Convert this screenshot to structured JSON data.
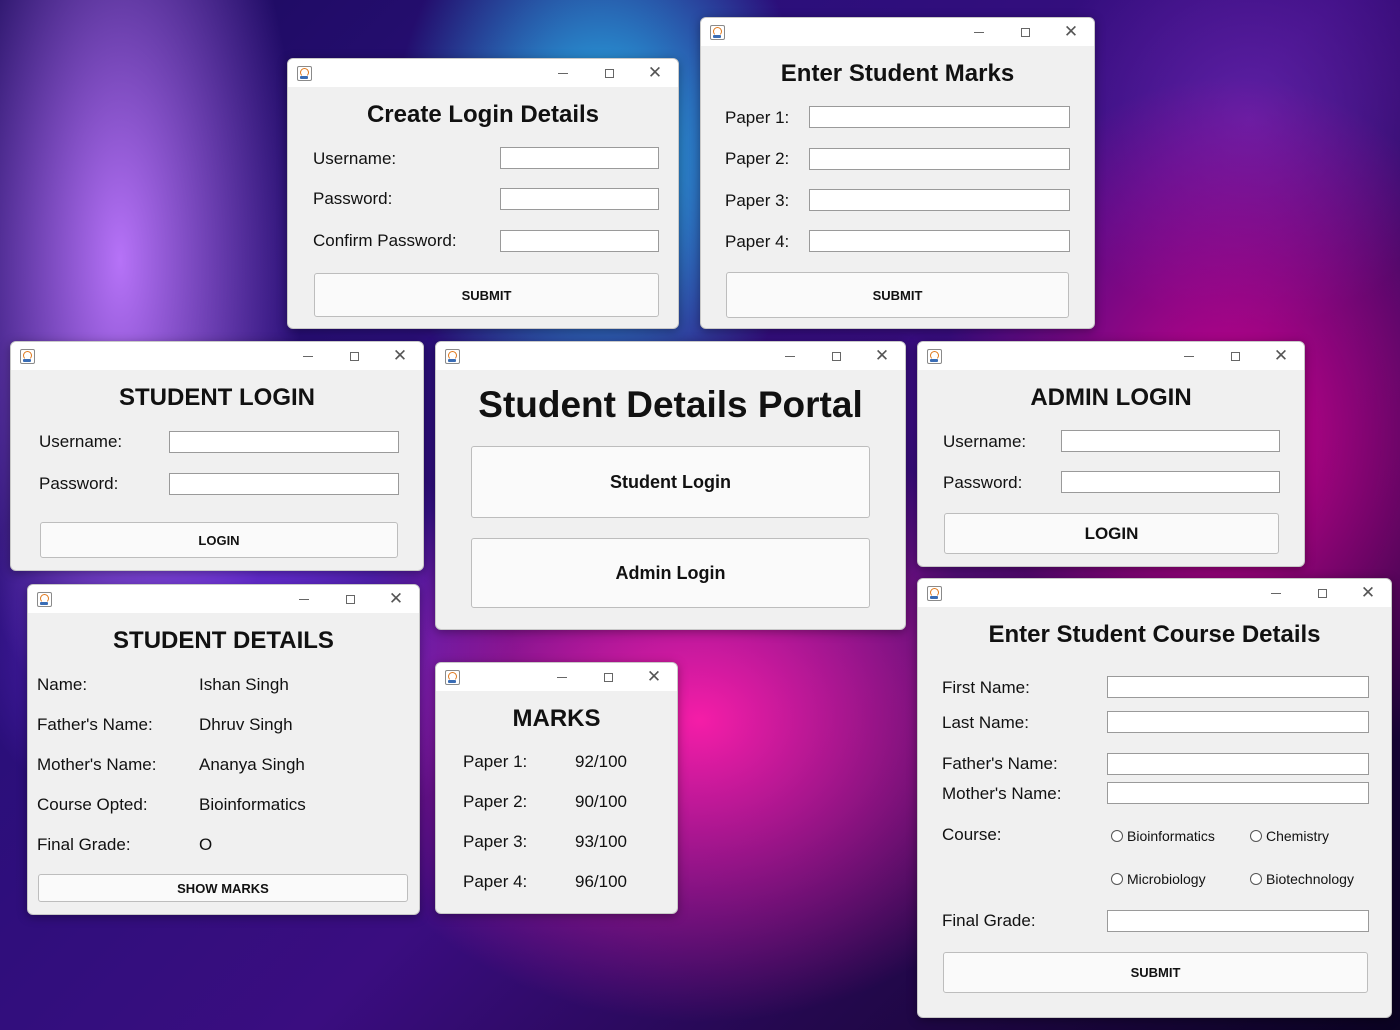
{
  "windows": {
    "create_login": {
      "title": "Create Login Details",
      "labels": [
        "Username:",
        "Password:",
        "Confirm Password:"
      ],
      "submit": "SUBMIT"
    },
    "enter_marks": {
      "title": "Enter Student Marks",
      "labels": [
        "Paper 1:",
        "Paper 2:",
        "Paper 3:",
        "Paper 4:"
      ],
      "submit": "SUBMIT"
    },
    "student_login": {
      "title": "STUDENT LOGIN",
      "labels": [
        "Username:",
        "Password:"
      ],
      "login": "LOGIN"
    },
    "portal": {
      "title": "Student Details Portal",
      "student_login": "Student Login",
      "admin_login": "Admin Login"
    },
    "admin_login": {
      "title": "ADMIN LOGIN",
      "labels": [
        "Username:",
        "Password:"
      ],
      "login": "LOGIN"
    },
    "student_details": {
      "title": "STUDENT DETAILS",
      "rows": [
        {
          "label": "Name:",
          "value": "Ishan Singh"
        },
        {
          "label": "Father's Name:",
          "value": "Dhruv Singh"
        },
        {
          "label": "Mother's Name:",
          "value": "Ananya Singh"
        },
        {
          "label": "Course Opted:",
          "value": "Bioinformatics"
        },
        {
          "label": "Final Grade:",
          "value": "O"
        }
      ],
      "show_marks": "SHOW MARKS"
    },
    "marks": {
      "title": "MARKS",
      "rows": [
        {
          "label": "Paper 1:",
          "value": "92/100"
        },
        {
          "label": "Paper 2:",
          "value": "90/100"
        },
        {
          "label": "Paper 3:",
          "value": "93/100"
        },
        {
          "label": "Paper 4:",
          "value": "96/100"
        }
      ]
    },
    "course_details": {
      "title": "Enter Student Course Details",
      "labels": {
        "first_name": "First Name:",
        "last_name": "Last Name:",
        "father": "Father's Name:",
        "mother": "Mother's Name:",
        "course": "Course:",
        "grade": "Final Grade:"
      },
      "courses": [
        "Bioinformatics",
        "Chemistry",
        "Microbiology",
        "Biotechnology"
      ],
      "submit": "SUBMIT"
    }
  }
}
